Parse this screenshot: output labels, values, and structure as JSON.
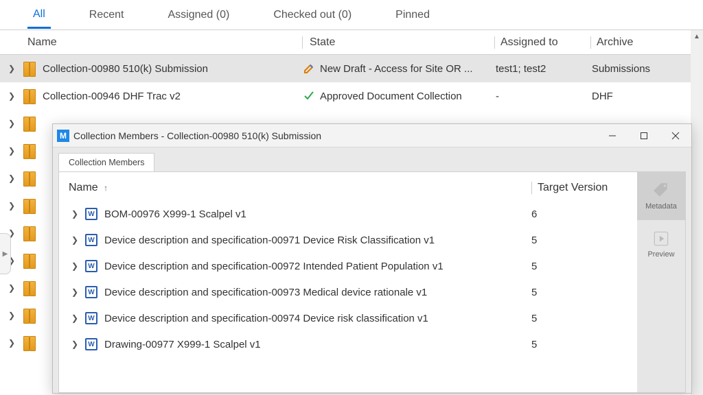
{
  "tabs": {
    "all": "All",
    "recent": "Recent",
    "assigned": "Assigned (0)",
    "checkedout": "Checked out (0)",
    "pinned": "Pinned"
  },
  "columns": {
    "name": "Name",
    "state": "State",
    "assigned": "Assigned to",
    "archive": "Archive"
  },
  "rows": [
    {
      "name": "Collection-00980 510(k) Submission",
      "state": "New Draft - Access for Site OR ...",
      "assigned": "test1; test2",
      "archive": "Submissions",
      "icon": "edit"
    },
    {
      "name": "Collection-00946 DHF Trac v2",
      "state": "Approved Document Collection",
      "assigned": "-",
      "archive": "DHF",
      "icon": "check"
    }
  ],
  "window": {
    "title": "Collection Members - Collection-00980 510(k) Submission",
    "tab": "Collection Members",
    "columns": {
      "name": "Name",
      "sort": "↑",
      "tv": "Target Version"
    },
    "side": {
      "metadata": "Metadata",
      "preview": "Preview"
    },
    "members": [
      {
        "name": "BOM-00976 X999-1 Scalpel v1",
        "tv": "6"
      },
      {
        "name": "Device description and specification-00971 Device Risk Classification v1",
        "tv": "5"
      },
      {
        "name": "Device description and specification-00972 Intended Patient Population v1",
        "tv": "5"
      },
      {
        "name": "Device description and specification-00973 Medical device rationale v1",
        "tv": "5"
      },
      {
        "name": "Device description and specification-00974 Device risk classification v1",
        "tv": "5"
      },
      {
        "name": "Drawing-00977 X999-1 Scalpel v1",
        "tv": "5"
      }
    ]
  }
}
